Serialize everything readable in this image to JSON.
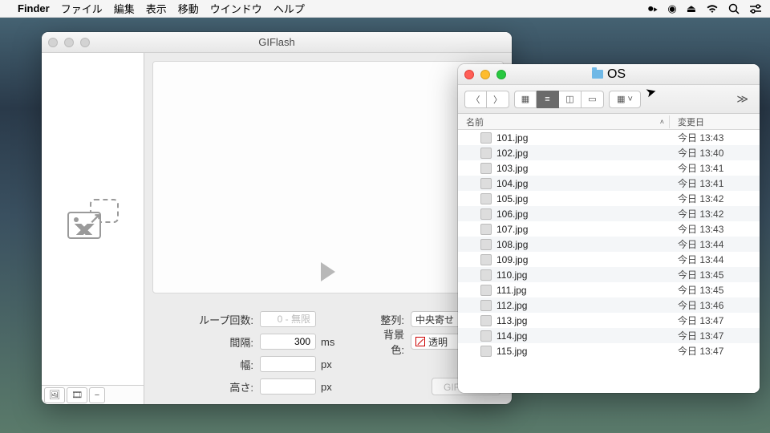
{
  "menubar": {
    "app": "Finder",
    "items": [
      "ファイル",
      "編集",
      "表示",
      "移動",
      "ウインドウ",
      "ヘルプ"
    ]
  },
  "gif_window": {
    "title": "GIFlash",
    "controls": {
      "loop_label": "ループ回数:",
      "loop_placeholder": "0 - 無限",
      "interval_label": "間隔:",
      "interval_value": "300",
      "interval_unit": "ms",
      "width_label": "幅:",
      "width_unit": "px",
      "height_label": "高さ:",
      "height_unit": "px",
      "align_label": "整列:",
      "align_value": "中央寄せ",
      "bg_label": "背景色:",
      "bg_value": "透明",
      "export_label": "GIFを出力"
    }
  },
  "finder_window": {
    "title": "OS",
    "columns": {
      "name": "名前",
      "date": "変更日"
    },
    "files": [
      {
        "name": "101.jpg",
        "date": "今日 13:43"
      },
      {
        "name": "102.jpg",
        "date": "今日 13:40"
      },
      {
        "name": "103.jpg",
        "date": "今日 13:41"
      },
      {
        "name": "104.jpg",
        "date": "今日 13:41"
      },
      {
        "name": "105.jpg",
        "date": "今日 13:42"
      },
      {
        "name": "106.jpg",
        "date": "今日 13:42"
      },
      {
        "name": "107.jpg",
        "date": "今日 13:43"
      },
      {
        "name": "108.jpg",
        "date": "今日 13:44"
      },
      {
        "name": "109.jpg",
        "date": "今日 13:44"
      },
      {
        "name": "110.jpg",
        "date": "今日 13:45"
      },
      {
        "name": "111.jpg",
        "date": "今日 13:45"
      },
      {
        "name": "112.jpg",
        "date": "今日 13:46"
      },
      {
        "name": "113.jpg",
        "date": "今日 13:47"
      },
      {
        "name": "114.jpg",
        "date": "今日 13:47"
      },
      {
        "name": "115.jpg",
        "date": "今日 13:47"
      }
    ]
  }
}
